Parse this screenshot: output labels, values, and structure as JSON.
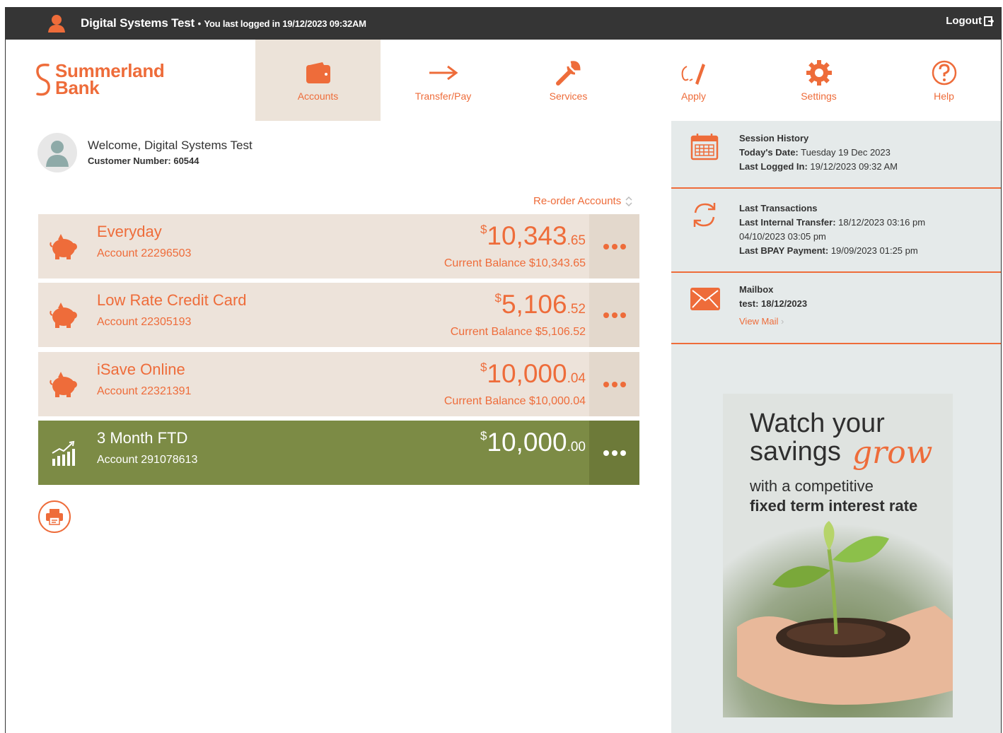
{
  "topbar": {
    "user_name": "Digital Systems Test",
    "separator": "•",
    "last_login": "You last logged in 19/12/2023 09:32AM",
    "logout_label": "Logout"
  },
  "brand": {
    "line1": "Summerland",
    "line2": "Bank",
    "color": "#ee6c3a"
  },
  "nav": [
    {
      "label": "Accounts",
      "icon": "wallet-icon",
      "active": true
    },
    {
      "label": "Transfer/Pay",
      "icon": "arrow-right-icon"
    },
    {
      "label": "Services",
      "icon": "wrench-icon"
    },
    {
      "label": "Apply",
      "icon": "pen-signature-icon"
    },
    {
      "label": "Settings",
      "icon": "gear-icon"
    },
    {
      "label": "Help",
      "icon": "question-icon"
    }
  ],
  "welcome": {
    "greeting": "Welcome, Digital Systems Test",
    "customer_number": "Customer Number: 60544"
  },
  "reorder_label": "Re-order Accounts",
  "accounts": [
    {
      "name": "Everyday",
      "number": "Account 22296503",
      "currency": "$",
      "whole": "10,343",
      "cents": ".65",
      "balance": "Current Balance $10,343.65",
      "icon": "piggy-bank-icon"
    },
    {
      "name": "Low Rate Credit Card",
      "number": "Account 22305193",
      "currency": "$",
      "whole": "5,106",
      "cents": ".52",
      "balance": "Current Balance $5,106.52",
      "icon": "piggy-bank-icon"
    },
    {
      "name": "iSave Online",
      "number": "Account 22321391",
      "currency": "$",
      "whole": "10,000",
      "cents": ".04",
      "balance": "Current Balance $10,000.04",
      "icon": "piggy-bank-icon"
    },
    {
      "name": "3 Month FTD",
      "number": "Account 291078613",
      "currency": "$",
      "whole": "10,000",
      "cents": ".00",
      "icon": "growth-chart-icon",
      "color": "#7c8b45"
    }
  ],
  "session": {
    "title": "Session History",
    "today_label": "Today's Date:",
    "today_value": "Tuesday 19 Dec 2023",
    "last_label": "Last Logged In:",
    "last_value": "19/12/2023 09:32 AM"
  },
  "transactions": {
    "title": "Last Transactions",
    "internal_label": "Last Internal Transfer:",
    "internal_value": "18/12/2023 03:16 pm",
    "extra_line": "04/10/2023 03:05 pm",
    "bpay_label": "Last BPAY Payment:",
    "bpay_value": "19/09/2023 01:25 pm"
  },
  "mailbox": {
    "title": "Mailbox",
    "message": "test: 18/12/2023",
    "view_label": "View Mail",
    "view_chevron": "›"
  },
  "ad": {
    "line1": "Watch your",
    "line2": "savings",
    "grow": "grow",
    "line3": "with a competitive",
    "line4": "fixed term interest rate"
  }
}
